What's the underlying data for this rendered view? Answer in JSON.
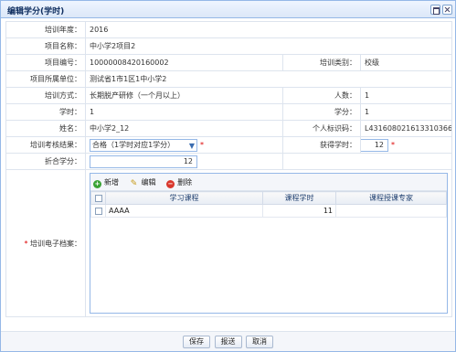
{
  "window": {
    "title": "编辑学分(学时)"
  },
  "fields": {
    "training_year": {
      "label": "培训年度：",
      "value": "2016"
    },
    "project_name": {
      "label": "项目名称：",
      "value": "中小学2项目2"
    },
    "project_code": {
      "label": "项目编号：",
      "value": "10000008420160002"
    },
    "training_category": {
      "label": "培训类别：",
      "value": "校级"
    },
    "project_unit": {
      "label": "项目所属单位：",
      "value": "测试省1市1区1中小学2"
    },
    "training_method": {
      "label": "培训方式：",
      "value": "长期脱产研修（一个月以上）"
    },
    "headcount": {
      "label": "人数：",
      "value": "1"
    },
    "hours": {
      "label": "学时：",
      "value": "1"
    },
    "credits": {
      "label": "学分：",
      "value": "1"
    },
    "name": {
      "label": "姓名：",
      "value": "中小学2_12"
    },
    "id_number": {
      "label": "个人标识码：",
      "value": "L431608021613310366"
    },
    "assessment_result": {
      "label": "培训考核结果：",
      "value": "合格（1学时对应1学分）"
    },
    "earned_hours": {
      "label": "获得学时：",
      "value": "12"
    },
    "converted_credits": {
      "label": "折合学分：",
      "value": "12"
    },
    "archive": {
      "label": "培训电子档案："
    }
  },
  "archive_grid": {
    "toolbar": {
      "add": "新增",
      "edit": "编辑",
      "delete": "删除"
    },
    "columns": [
      "学习课程",
      "课程学时",
      "课程授课专家"
    ],
    "rows": [
      {
        "course": "AAAA",
        "hours": "11",
        "expert": ""
      }
    ]
  },
  "footer": {
    "save": "保存",
    "submit": "报送",
    "cancel": "取消"
  }
}
